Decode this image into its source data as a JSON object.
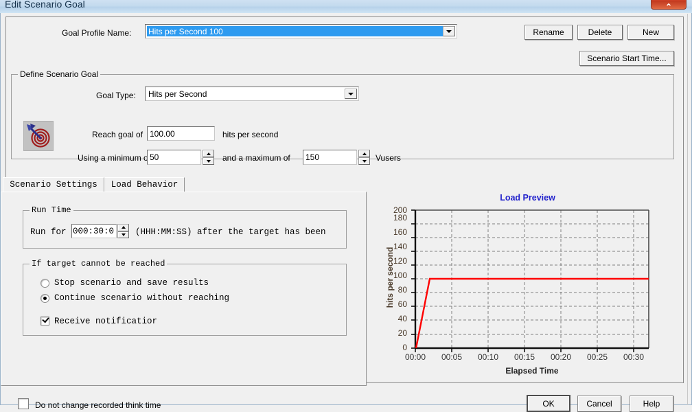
{
  "window": {
    "title": "Edit Scenario Goal",
    "close_label": "⌃"
  },
  "profile": {
    "label": "Goal Profile Name:",
    "value": "Hits per Second 100",
    "rename_label": "Rename",
    "delete_label": "Delete",
    "new_label": "New",
    "scenario_start_time_label": "Scenario Start Time..."
  },
  "define_goal": {
    "group_title": "Define Scenario Goal",
    "goal_type_label": "Goal Type:",
    "goal_type_value": "Hits per Second",
    "reach_goal_label": "Reach goal of",
    "reach_goal_value": "100.00",
    "reach_goal_units": "hits per second",
    "minimum_label": "Using a minimum of",
    "minimum_value": "50",
    "maximum_label": "and a maximum of",
    "maximum_value": "150",
    "vusers_label": "Vusers"
  },
  "tabs": [
    {
      "label": "Scenario Settings",
      "active": true
    },
    {
      "label": "Load Behavior",
      "active": false
    }
  ],
  "run_time": {
    "group_title": "Run Time",
    "prefix_label": "Run for",
    "value": "000:30:0",
    "suffix_label": "(HHH:MM:SS)  after the target has been"
  },
  "target_fail": {
    "group_title": "If target cannot be reached",
    "options": [
      {
        "label": "Stop scenario and save results",
        "selected": false
      },
      {
        "label": "Continue scenario without reaching",
        "selected": true
      }
    ],
    "notification": {
      "label": "Receive notificatior",
      "checked": true
    }
  },
  "footer": {
    "think_time_label": "Do not change recorded think time",
    "think_time_checked": false,
    "ok_label": "OK",
    "cancel_label": "Cancel",
    "help_label": "Help"
  },
  "chart_data": {
    "type": "line",
    "title": "Load Preview",
    "xlabel": "Elapsed Time",
    "ylabel": "hits per second",
    "ylim": [
      0,
      200
    ],
    "yticks": [
      0,
      20,
      40,
      60,
      80,
      100,
      120,
      140,
      160,
      180,
      200
    ],
    "xticks": [
      "00:00",
      "00:05",
      "00:10",
      "00:15",
      "00:20",
      "00:25",
      "00:30"
    ],
    "xtick_values": [
      0,
      5,
      10,
      15,
      20,
      25,
      30
    ],
    "xlim": [
      0,
      32
    ],
    "grid": true,
    "legend": "none",
    "series": [
      {
        "name": "hits per second",
        "color": "#ff0000",
        "x": [
          0,
          2,
          32
        ],
        "values": [
          0,
          100,
          100
        ]
      }
    ]
  },
  "colors": {
    "accent": "#2e9bf0",
    "chart_line": "#ff0000",
    "chart_title": "#2222cc",
    "titlebar": "#c3daee",
    "close_button": "#d7472a"
  }
}
